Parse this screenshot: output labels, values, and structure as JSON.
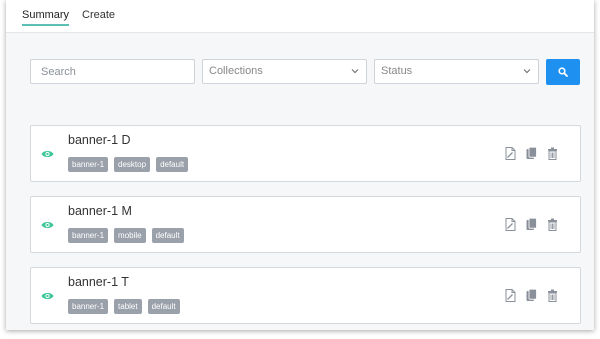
{
  "tabs": {
    "summary_label": "Summary",
    "create_label": "Create"
  },
  "filters": {
    "search_placeholder": "Search",
    "collections_label": "Collections",
    "status_label": "Status"
  },
  "colors": {
    "accent": "#5bc0b4",
    "primary_button": "#1e90f0",
    "visible_icon": "#3fc79a",
    "tag_bg": "#9aa1ab"
  },
  "items": [
    {
      "title": "banner-1 D",
      "tags": [
        "banner-1",
        "desktop",
        "default"
      ]
    },
    {
      "title": "banner-1 M",
      "tags": [
        "banner-1",
        "mobile",
        "default"
      ]
    },
    {
      "title": "banner-1 T",
      "tags": [
        "banner-1",
        "tablet",
        "default"
      ]
    }
  ]
}
